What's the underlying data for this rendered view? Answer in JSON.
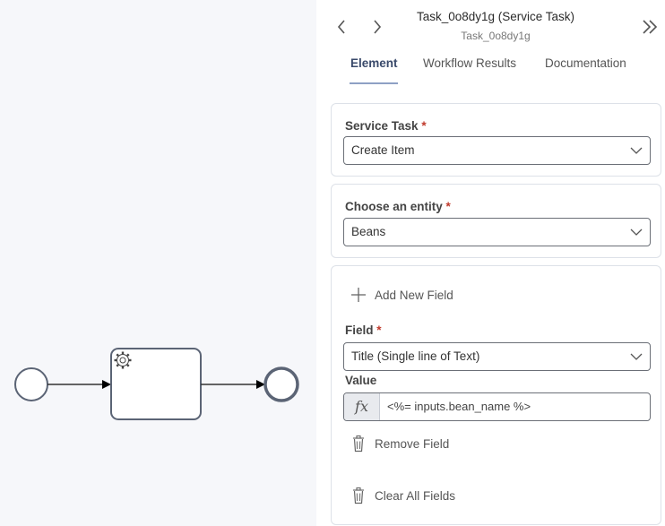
{
  "header": {
    "title": "Task_0o8dy1g (Service Task)",
    "subtitle": "Task_0o8dy1g"
  },
  "tabs": [
    {
      "label": "Element",
      "active": true
    },
    {
      "label": "Workflow Results",
      "active": false
    },
    {
      "label": "Documentation",
      "active": false
    }
  ],
  "service_task": {
    "label": "Service Task",
    "value": "Create Item"
  },
  "entity": {
    "label": "Choose an entity",
    "value": "Beans"
  },
  "fields": {
    "add_label": "Add New Field",
    "field_label": "Field",
    "field_value": "Title (Single line of Text)",
    "value_label": "Value",
    "fx_symbol": "fx",
    "value_expression": "<%= inputs.bean_name %>",
    "remove_label": "Remove Field",
    "clear_label": "Clear All Fields"
  },
  "required_marker": "*",
  "colors": {
    "accent": "#8ea0c4",
    "required": "#c0392b",
    "canvas_bg": "#f6f7fa",
    "bpmn_stroke": "#5b6475"
  },
  "icons": [
    "chevron-left-icon",
    "chevron-right-icon",
    "double-chevron-right-icon",
    "chevron-down-icon",
    "plus-icon",
    "trash-icon",
    "gear-icon"
  ]
}
